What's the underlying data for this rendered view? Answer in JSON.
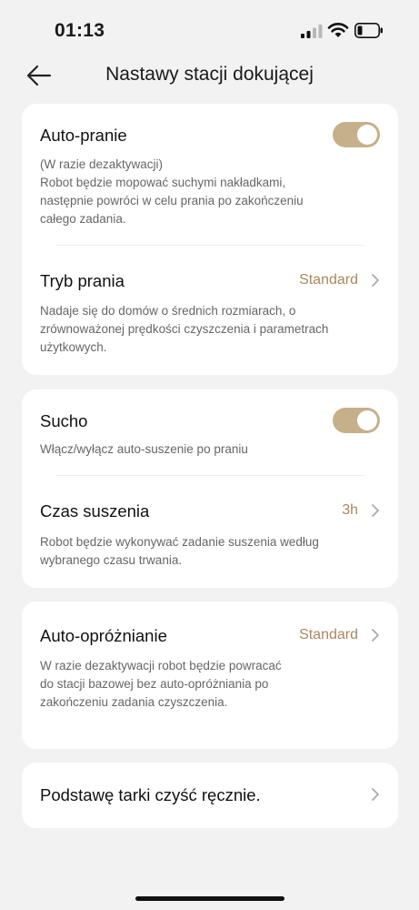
{
  "status_bar": {
    "time": "01:13"
  },
  "header": {
    "title": "Nastawy stacji dokującej"
  },
  "cards": {
    "wash": {
      "auto_wash": {
        "title": "Auto-pranie",
        "desc": "(W razie dezaktywacji)\nRobot będzie mopować suchymi nakładkami, następnie powróci w celu prania po zakończeniu całego zadania.",
        "enabled": true
      },
      "wash_mode": {
        "title": "Tryb prania",
        "value": "Standard",
        "desc": "Nadaje się do domów o średnich rozmiarach, o zrównoważonej prędkości czyszczenia i parametrach użytkowych."
      }
    },
    "dry": {
      "dry_toggle": {
        "title": "Sucho",
        "desc": "Włącz/wyłącz auto-suszenie po praniu",
        "enabled": true
      },
      "dry_time": {
        "title": "Czas suszenia",
        "value": "3h",
        "desc": "Robot będzie wykonywać zadanie suszenia według wybranego czasu trwania."
      }
    },
    "auto_empty": {
      "title": "Auto-opróżnianie",
      "value": "Standard",
      "desc": "W razie dezaktywacji robot będzie powracać do stacji bazowej bez auto-opróżniania po zakończeniu zadania czyszczenia."
    },
    "manual_clean": {
      "title": "Podstawę tarki czyść ręcznie."
    }
  },
  "colors": {
    "accent": "#c6b08a",
    "value_text": "#a8895e",
    "background": "#f2f2f2",
    "card": "#ffffff"
  },
  "icons": [
    "back-arrow-icon",
    "signal-icon",
    "wifi-icon",
    "battery-icon",
    "chevron-right-icon"
  ]
}
